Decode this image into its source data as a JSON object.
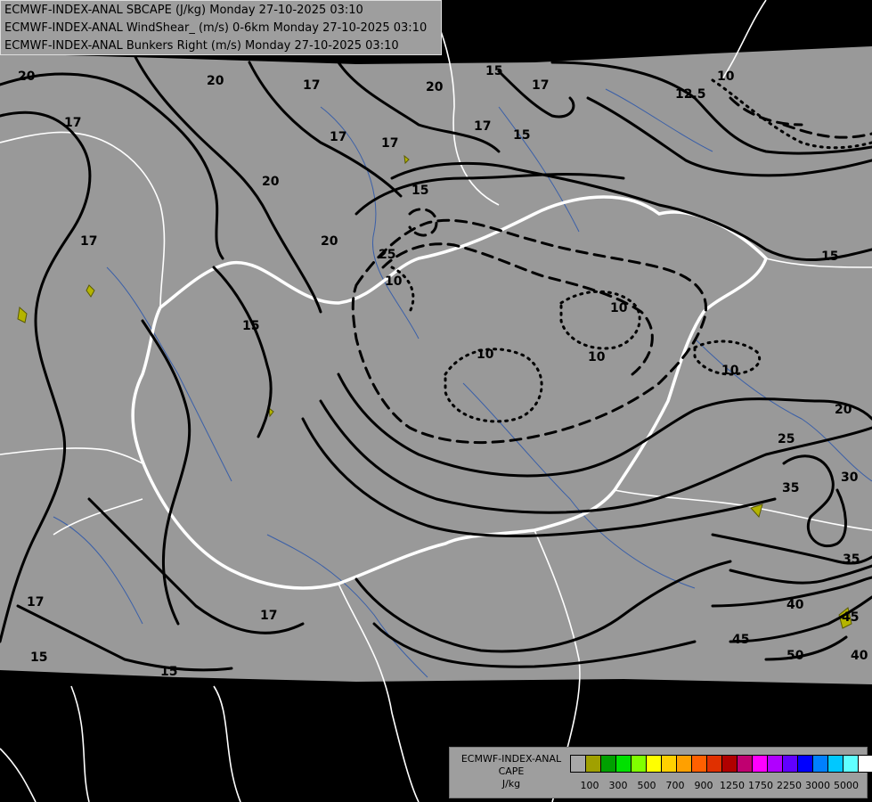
{
  "header": {
    "lines": [
      "ECMWF-INDEX-ANAL SBCAPE (J/kg) Monday 27-10-2025 03:10",
      "ECMWF-INDEX-ANAL WindShear_ (m/s) 0-6km Monday 27-10-2025 03:10",
      "ECMWF-INDEX-ANAL Bunkers Right (m/s) Monday 27-10-2025 03:10"
    ]
  },
  "map": {
    "background_color": "#999999",
    "outside_color": "#000000",
    "contour_color": "#000000",
    "border_color": "#ffffff",
    "river_color": "#3a5fa8",
    "contour_labels": [
      "20",
      "20",
      "17",
      "17",
      "17",
      "20",
      "17",
      "20",
      "15",
      "17",
      "15",
      "17",
      "20",
      "12.5",
      "10",
      "17",
      "15",
      "25",
      "10",
      "15",
      "10",
      "10",
      "10",
      "10",
      "15",
      "20",
      "25",
      "30",
      "35",
      "35",
      "40",
      "45",
      "50",
      "45",
      "40",
      "17",
      "17",
      "15",
      "15"
    ]
  },
  "legend": {
    "title_lines": [
      "ECMWF-INDEX-ANAL",
      "CAPE",
      "J/kg"
    ],
    "colors": [
      "#a8a8a8",
      "#a0a000",
      "#00a000",
      "#00e000",
      "#80ff00",
      "#ffff00",
      "#ffd000",
      "#ffa000",
      "#ff6000",
      "#e03000",
      "#b00000",
      "#c00070",
      "#ff00ff",
      "#b000ff",
      "#6000ff",
      "#0000ff",
      "#0080ff",
      "#00c8ff",
      "#60ffff",
      "#ffffff"
    ],
    "tick_labels": [
      "100",
      "300",
      "500",
      "700",
      "900",
      "1250",
      "1750",
      "2250",
      "3000",
      "5000"
    ]
  }
}
